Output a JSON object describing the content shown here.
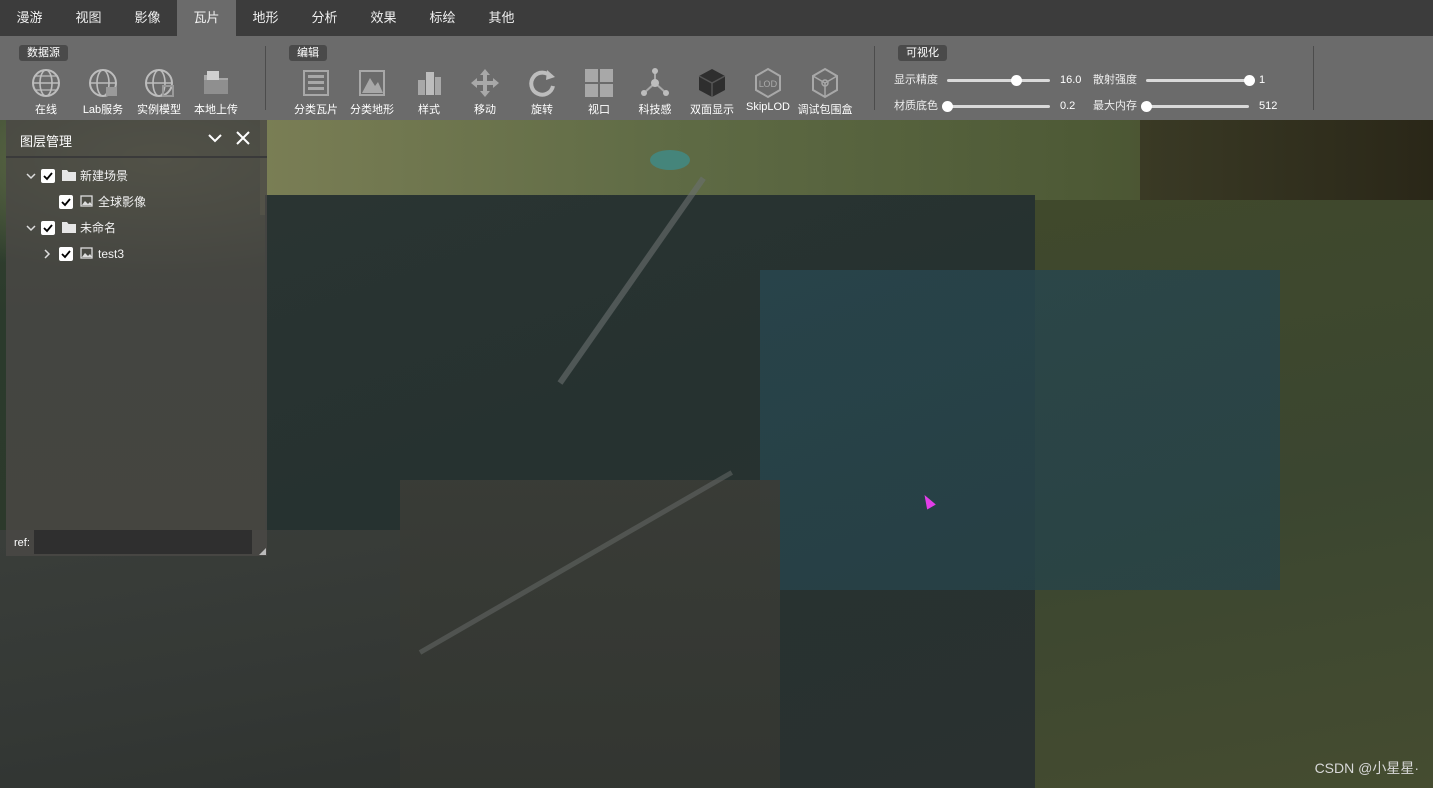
{
  "menubar": {
    "items": [
      "漫游",
      "视图",
      "影像",
      "瓦片",
      "地形",
      "分析",
      "效果",
      "标绘",
      "其他"
    ],
    "active": "瓦片"
  },
  "ribbon": {
    "groups": [
      {
        "label": "数据源",
        "tools": [
          "在线",
          "Lab服务",
          "实例模型",
          "本地上传"
        ]
      },
      {
        "label": "编辑",
        "tools": [
          "分类瓦片",
          "分类地形",
          "样式",
          "移动",
          "旋转",
          "视口",
          "科技感",
          "双面显示",
          "SkipLOD",
          "调试包围盒"
        ]
      },
      {
        "label": "可视化"
      }
    ],
    "sliders": [
      {
        "label": "显示精度",
        "value": "16.0",
        "fraction": 0.67
      },
      {
        "label": "散射强度",
        "value": "1",
        "fraction": 1.0
      },
      {
        "label": "材质底色",
        "value": "0.2",
        "fraction": 0.0
      },
      {
        "label": "最大内存",
        "value": "512",
        "fraction": 0.0
      }
    ]
  },
  "layer_panel": {
    "title": "图层管理",
    "tree": [
      {
        "label": "新建场景",
        "checked": true,
        "expanded": true,
        "type": "folder"
      },
      {
        "label": "全球影像",
        "checked": true,
        "type": "image"
      },
      {
        "label": "未命名",
        "checked": true,
        "expanded": true,
        "type": "folder"
      },
      {
        "label": "test3",
        "checked": true,
        "expanded": false,
        "type": "image"
      }
    ],
    "ref_label": "ref:",
    "ref_value": ""
  },
  "watermark": "CSDN @小星星·",
  "colors": {
    "menubar_bg": "#3c3c3c",
    "ribbon_bg": "#6b6b6b",
    "group_label_bg": "#4a4a4a",
    "cursor": "#e23ee8"
  }
}
